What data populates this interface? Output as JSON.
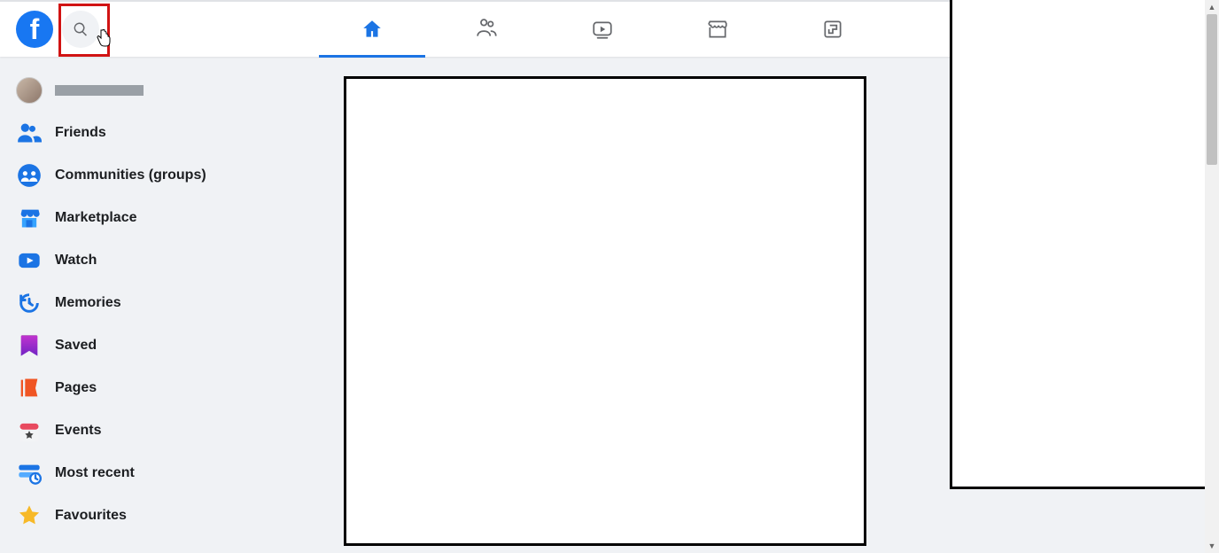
{
  "header": {
    "logo_letter": "f",
    "nav": [
      {
        "name": "home",
        "active": true
      },
      {
        "name": "friends",
        "active": false
      },
      {
        "name": "watch",
        "active": false
      },
      {
        "name": "marketplace",
        "active": false
      },
      {
        "name": "gaming",
        "active": false
      }
    ]
  },
  "sidebar": {
    "items": [
      {
        "label": "",
        "icon": "profile"
      },
      {
        "label": "Friends",
        "icon": "friends"
      },
      {
        "label": "Communities (groups)",
        "icon": "groups"
      },
      {
        "label": "Marketplace",
        "icon": "marketplace"
      },
      {
        "label": "Watch",
        "icon": "watch"
      },
      {
        "label": "Memories",
        "icon": "memories"
      },
      {
        "label": "Saved",
        "icon": "saved"
      },
      {
        "label": "Pages",
        "icon": "pages"
      },
      {
        "label": "Events",
        "icon": "events"
      },
      {
        "label": "Most recent",
        "icon": "recent"
      },
      {
        "label": "Favourites",
        "icon": "favourites"
      }
    ]
  }
}
